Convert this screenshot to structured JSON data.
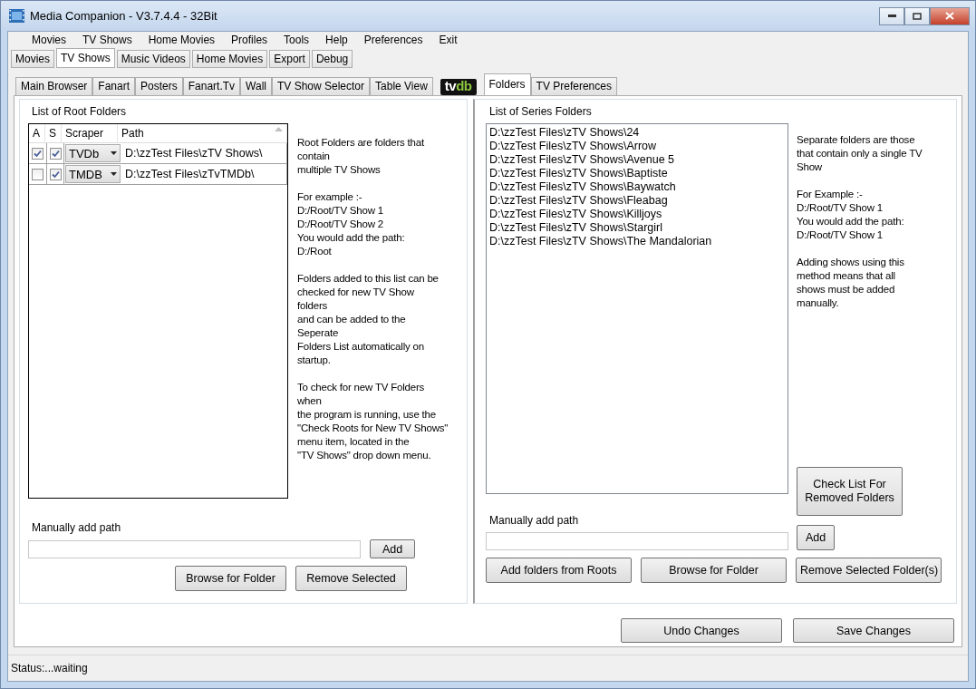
{
  "window": {
    "title": "Media Companion - V3.7.4.4 - 32Bit"
  },
  "menu": [
    "Movies",
    "TV Shows",
    "Home Movies",
    "Profiles",
    "Tools",
    "Help",
    "Preferences",
    "Exit"
  ],
  "main_tabs": [
    {
      "label": "Movies",
      "selected": false
    },
    {
      "label": "TV Shows",
      "selected": true
    },
    {
      "label": "Music Videos",
      "selected": false
    },
    {
      "label": "Home Movies",
      "selected": false
    },
    {
      "label": "Export",
      "selected": false
    },
    {
      "label": "Debug",
      "selected": false
    }
  ],
  "sub_tabs": [
    {
      "kind": "text",
      "label": "Main Browser",
      "selected": false
    },
    {
      "kind": "text",
      "label": "Fanart",
      "selected": false
    },
    {
      "kind": "text",
      "label": "Posters",
      "selected": false
    },
    {
      "kind": "text",
      "label": "Fanart.Tv",
      "selected": false
    },
    {
      "kind": "text",
      "label": "Wall",
      "selected": false
    },
    {
      "kind": "text",
      "label": "TV Show Selector",
      "selected": false
    },
    {
      "kind": "text",
      "label": "Table View",
      "selected": false
    },
    {
      "kind": "logo",
      "parts": [
        "tv",
        "db"
      ],
      "selected": false
    },
    {
      "kind": "text",
      "label": "Folders",
      "selected": true
    },
    {
      "kind": "text",
      "label": "TV Preferences",
      "selected": false
    }
  ],
  "root_folders": {
    "title": "List of Root Folders",
    "columns": [
      "A",
      "S",
      "Scraper",
      "Path"
    ],
    "rows": [
      {
        "a_checked": true,
        "s_checked": true,
        "scraper": "TVDb",
        "path": "D:\\zzTest Files\\zTV Shows\\"
      },
      {
        "a_checked": false,
        "s_checked": true,
        "scraper": "TMDB",
        "path": "D:\\zzTest Files\\zTvTMDb\\"
      }
    ],
    "help": [
      "Root Folders are folders that\ncontain\nmultiple TV Shows",
      "For example :-\nD:/Root/TV Show 1\nD:/Root/TV Show 2\nYou would add the path:\nD:/Root",
      "Folders added to this list can be\nchecked for new TV Show\nfolders\nand can be added to the\nSeperate\nFolders List automatically on\nstartup.",
      "To check for new TV Folders\nwhen\nthe program is running, use the\n\"Check Roots for New TV Shows\"\nmenu item, located in the\n\"TV Shows\" drop down menu."
    ],
    "manual_label": "Manually add path",
    "add_button": "Add",
    "buttons": [
      "Browse for Folder",
      "Remove Selected"
    ]
  },
  "series_folders": {
    "title": "List of Series Folders",
    "items": [
      "D:\\zzTest Files\\zTV Shows\\24",
      "D:\\zzTest Files\\zTV Shows\\Arrow",
      "D:\\zzTest Files\\zTV Shows\\Avenue 5",
      "D:\\zzTest Files\\zTV Shows\\Baptiste",
      "D:\\zzTest Files\\zTV Shows\\Baywatch",
      "D:\\zzTest Files\\zTV Shows\\Fleabag",
      "D:\\zzTest Files\\zTV Shows\\Killjoys",
      "D:\\zzTest Files\\zTV Shows\\Stargirl",
      "D:\\zzTest Files\\zTV Shows\\The Mandalorian"
    ],
    "help": [
      "Separate folders are those\nthat contain only a single TV\nShow",
      "For Example :-\nD:/Root/TV Show 1\nYou would add the path:\nD:/Root/TV Show 1",
      "Adding shows using this\nmethod means that all\nshows must be added\nmanually."
    ],
    "check_button": "Check List For\nRemoved Folders",
    "manual_label": "Manually add path",
    "add_button": "Add",
    "buttons": [
      "Add folders from Roots",
      "Browse for Folder",
      "Remove Selected Folder(s)"
    ]
  },
  "footer_buttons": [
    "Undo Changes",
    "Save Changes"
  ],
  "status_bar": "Status:...waiting"
}
